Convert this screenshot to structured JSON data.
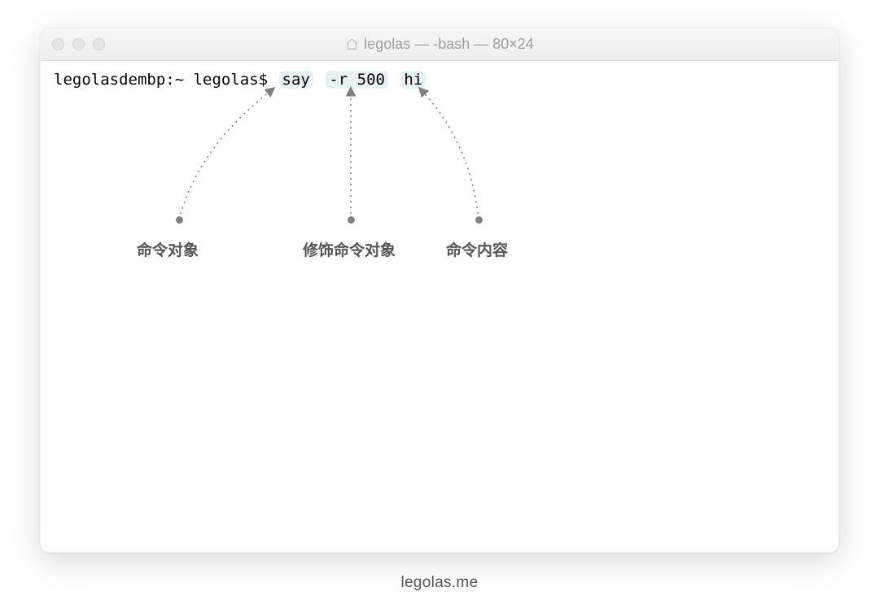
{
  "window": {
    "title": "legolas — -bash — 80×24"
  },
  "terminal": {
    "prompt": "legolasdembp:~ legolas$ ",
    "parts": {
      "cmd": "say",
      "flag": "-r 500",
      "arg": "hi"
    }
  },
  "annotations": {
    "left": "命令对象",
    "middle": "修饰命令对象",
    "right": "命令内容"
  },
  "footer": "legolas.me"
}
